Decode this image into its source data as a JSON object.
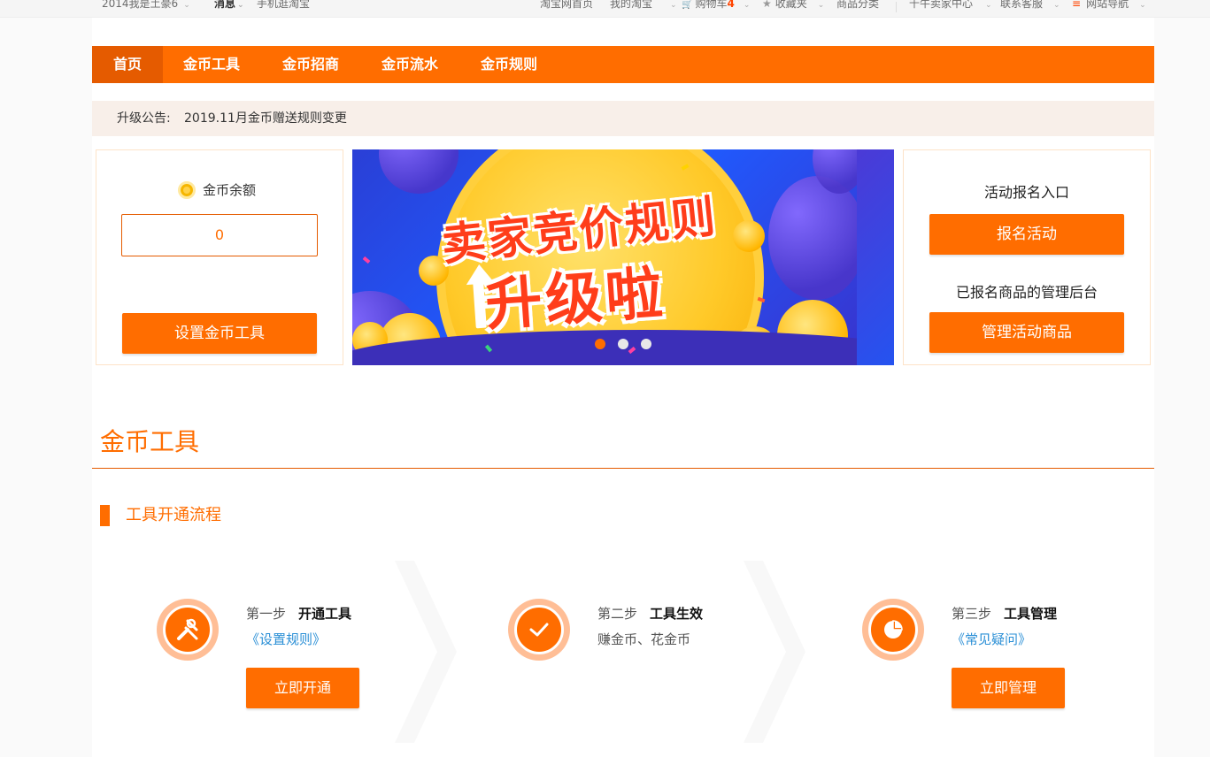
{
  "site_nav": {
    "user": "2014我是土豪6",
    "messages": "消息",
    "mobile": "手机逛淘宝",
    "home": "淘宝网首页",
    "my_taobao": "我的淘宝",
    "cart": "购物车",
    "cart_count": "4",
    "favorites": "收藏夹",
    "categories": "商品分类",
    "seller_center": "千牛卖家中心",
    "customer_service": "联系客服",
    "site_nav": "网站导航"
  },
  "main_nav": {
    "tabs": [
      "首页",
      "金币工具",
      "金币招商",
      "金币流水",
      "金币规则"
    ],
    "active_index": 0
  },
  "notice": {
    "label": "升级公告:",
    "text": "2019.11月金币赠送规则变更"
  },
  "balance": {
    "title": "金币余额",
    "value": "0",
    "setup_button": "设置金币工具"
  },
  "banner": {
    "line1": "卖家竞价规则",
    "line2": "升级啦",
    "slide_count": 3,
    "active_slide": 0
  },
  "activity": {
    "signup_label": "活动报名入口",
    "signup_button": "报名活动",
    "manage_label": "已报名商品的管理后台",
    "manage_button": "管理活动商品"
  },
  "section": {
    "title": "金币工具",
    "subtitle": "工具开通流程"
  },
  "steps": [
    {
      "num": "第一步",
      "name": "开通工具",
      "link": "《设置规则》",
      "button": "立即开通",
      "icon": "tools-icon"
    },
    {
      "num": "第二步",
      "name": "工具生效",
      "desc": "赚金币、花金币",
      "icon": "check-icon"
    },
    {
      "num": "第三步",
      "name": "工具管理",
      "link": "《常见疑问》",
      "button": "立即管理",
      "icon": "pie-chart-icon"
    }
  ],
  "colors": {
    "accent": "#ff6d00",
    "accent_dark": "#e55b00",
    "link": "#2a8fd6",
    "notice_bg": "#f8efe9"
  }
}
